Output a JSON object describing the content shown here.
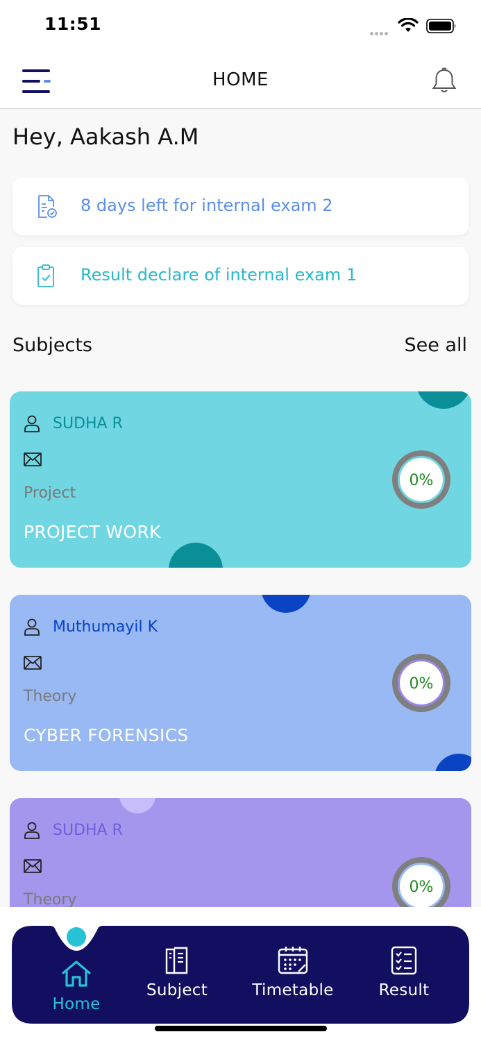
{
  "status_bar": {
    "time": "11:51"
  },
  "header": {
    "title": "HOME"
  },
  "greeting": "Hey, Aakash A.M",
  "notices": [
    {
      "text": "8 days left for internal exam 2",
      "icon": "exam-document-icon",
      "color": "#5b8fe6"
    },
    {
      "text": "Result declare of internal exam 1",
      "icon": "clipboard-check-icon",
      "color": "#28b8c9"
    }
  ],
  "subjects_section": {
    "title": "Subjects",
    "see_all": "See all"
  },
  "subjects": [
    {
      "teacher": "SUDHA R",
      "type": "Project",
      "name": "PROJECT WORK",
      "progress": "0%",
      "color": "#6fd6e2"
    },
    {
      "teacher": "Muthumayil K",
      "type": "Theory",
      "name": "CYBER FORENSICS",
      "progress": "0%",
      "color": "#98b9f3"
    },
    {
      "teacher": "SUDHA R",
      "type": "Theory",
      "name": "",
      "progress": "0%",
      "color": "#a496ec"
    }
  ],
  "tabbar": {
    "active": "Home",
    "tabs": [
      {
        "label": "Home",
        "icon": "home-icon"
      },
      {
        "label": "Subject",
        "icon": "book-icon"
      },
      {
        "label": "Timetable",
        "icon": "calendar-icon"
      },
      {
        "label": "Result",
        "icon": "checklist-icon"
      }
    ],
    "background": "#130f60",
    "active_color": "#27c2d6"
  }
}
